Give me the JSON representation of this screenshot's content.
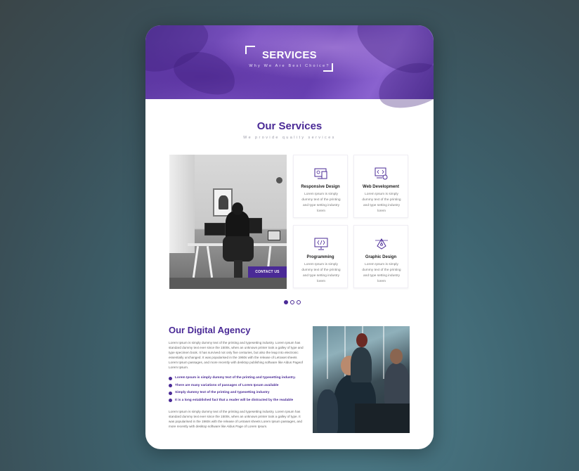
{
  "hero": {
    "title": "SERVICES",
    "subtitle": "Why We Are Best Choice?"
  },
  "services_section": {
    "title": "Our Services",
    "subtitle": "We provide quality services",
    "contact_button": "CONTACT US",
    "cards": [
      {
        "icon": "responsive-design-icon",
        "title": "Responsive Design",
        "desc": "Lorem Ipsum is simply dummy text of the printing and type setting industry lorem"
      },
      {
        "icon": "web-development-icon",
        "title": "Web Development",
        "desc": "Lorem Ipsum is simply dummy text of the printing and type setting industry lorem"
      },
      {
        "icon": "programming-icon",
        "title": "Programming",
        "desc": "Lorem Ipsum is simply dummy text of the printing and type setting industry lorem"
      },
      {
        "icon": "graphic-design-icon",
        "title": "Graphic Design",
        "desc": "Lorem Ipsum is simply dummy text of the printing and type setting industry lorem"
      }
    ],
    "carousel": {
      "pages": 3,
      "active": 1
    }
  },
  "agency": {
    "title": "Our Digital Agency",
    "paragraph1": "Lorem Ipsum is simply dummy text of the printing and typesetting industry. Lorem Ipsum has standard dummy text ever since the 1500s, when an unknown printer took a galley of type and type specimen book. It has survived not only five centuries, but also the leap into electronic essentially unchanged. It was popularised in the 1960s with the release of Letraset sheets Lorem Ipsum passages, and more recently with desktop publishing software like Aldus Pageof Lorem Ipsum.",
    "bullets": [
      "Lorem Ipsum is simply dummy text of the printing and typesetting industry.",
      "There are many variations of passages of Lorem Ipsum available",
      "Simply dummy text of the printing and typesetting industry",
      "It is a long established fact that a reader will be distracted by the readable"
    ],
    "paragraph2": "Lorem Ipsum is simply dummy text of the printing and typesetting industry. Lorem Ipsum has standard dummy text ever since the 1500s, when an unknown printer took a galley of type. It was popularised in the 1960s with the release of Letraset sheets Lorem Ipsum passages, and more recently with desktop software like Aldus Page of Lorem Ipsum."
  },
  "colors": {
    "accent": "#4a2a96",
    "hero": "#6a43b5",
    "background": "#3e6470"
  }
}
